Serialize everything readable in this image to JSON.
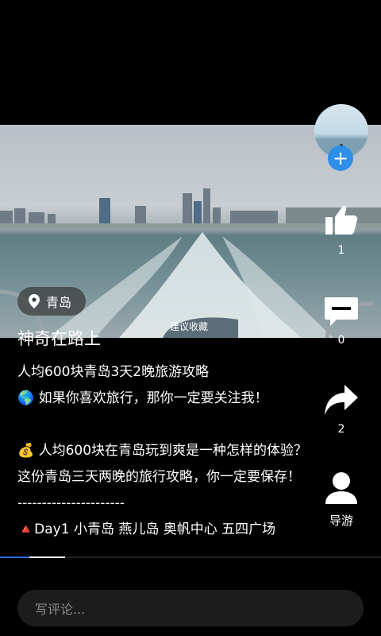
{
  "video": {
    "location": "青岛",
    "collect_hint": "建议收藏",
    "progress_fraction": 0.17
  },
  "post": {
    "title": "神奇在路上",
    "lines": [
      "人均600块青岛3天2晚旅游攻略",
      "🌎 如果你喜欢旅行，那你一定要关注我！",
      "",
      "💰 人均600块在青岛玩到爽是一种怎样的体验？这份青岛三天两晚的旅行攻略，你一定要保存！",
      "----------------------",
      "🔺Day1  小青岛  燕儿岛  奥帆中心  五四广场"
    ]
  },
  "actions": {
    "like_count": "1",
    "comment_count": "0",
    "share_count": "2",
    "guide_label": "导游"
  },
  "comment_box": {
    "placeholder": "写评论..."
  },
  "colors": {
    "follow": "#2e8fe8",
    "background": "#000000"
  }
}
